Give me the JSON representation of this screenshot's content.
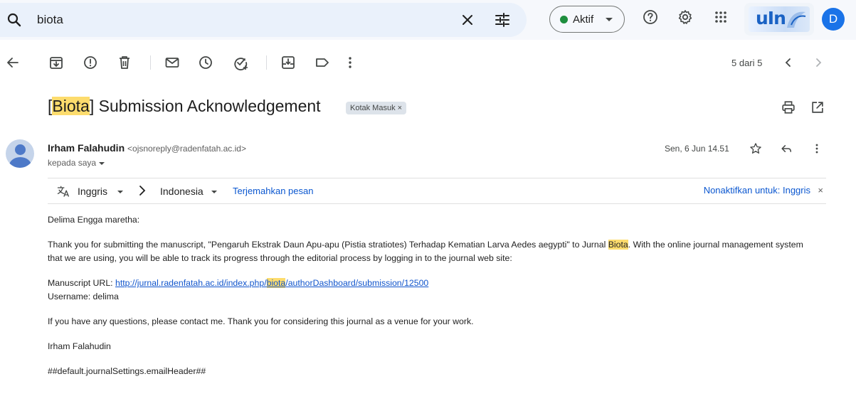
{
  "search": {
    "query": "biota",
    "status_label": "Aktif",
    "status_color": "#1e8e3e",
    "icons": [
      "search-icon",
      "close-icon",
      "tune-icon",
      "help-icon",
      "gear-icon",
      "apps-icon"
    ]
  },
  "account": {
    "logo_text": "uIn",
    "initial": "D",
    "avatar_color": "#1a73e8"
  },
  "toolbar": {
    "count": "5 dari 5"
  },
  "subject": {
    "prefix": "[",
    "highlight": "Biota",
    "rest": "] Submission Acknowledgement",
    "label": "Kotak Masuk",
    "label_close": "×"
  },
  "sender": {
    "name": "Irham Falahudin",
    "email": "<ojsnoreply@radenfatah.ac.id>",
    "to": "kepada saya",
    "date": "Sen, 6 Jun 14.51"
  },
  "translate": {
    "from": "Inggris",
    "to": "Indonesia",
    "action": "Terjemahkan pesan",
    "disable": "Nonaktifkan untuk: Inggris",
    "close": "×"
  },
  "body": {
    "greeting": "Delima Engga maretha:",
    "p1_a": "Thank you for submitting the manuscript, \"Pengaruh Ekstrak Daun Apu-apu (Pistia stratiotes) Terhadap Kematian Larva Aedes aegypti\" to Jurnal ",
    "p1_hl": "Biota",
    "p1_b": ". With the online journal management system that we are using, you will be able to track its progress through the editorial process by logging in to the journal web site:",
    "url_label": "Manuscript URL: ",
    "url_a": "http://jurnal.radenfatah.ac.id/index.php/",
    "url_hl": "biota",
    "url_b": "/authorDashboard/submission/12500",
    "username": "Username: delima",
    "p2": "If you have any questions, please contact me. Thank you for considering this journal as a venue for your work.",
    "signature": "Irham Falahudin",
    "footer": "##default.journalSettings.emailHeader##"
  }
}
